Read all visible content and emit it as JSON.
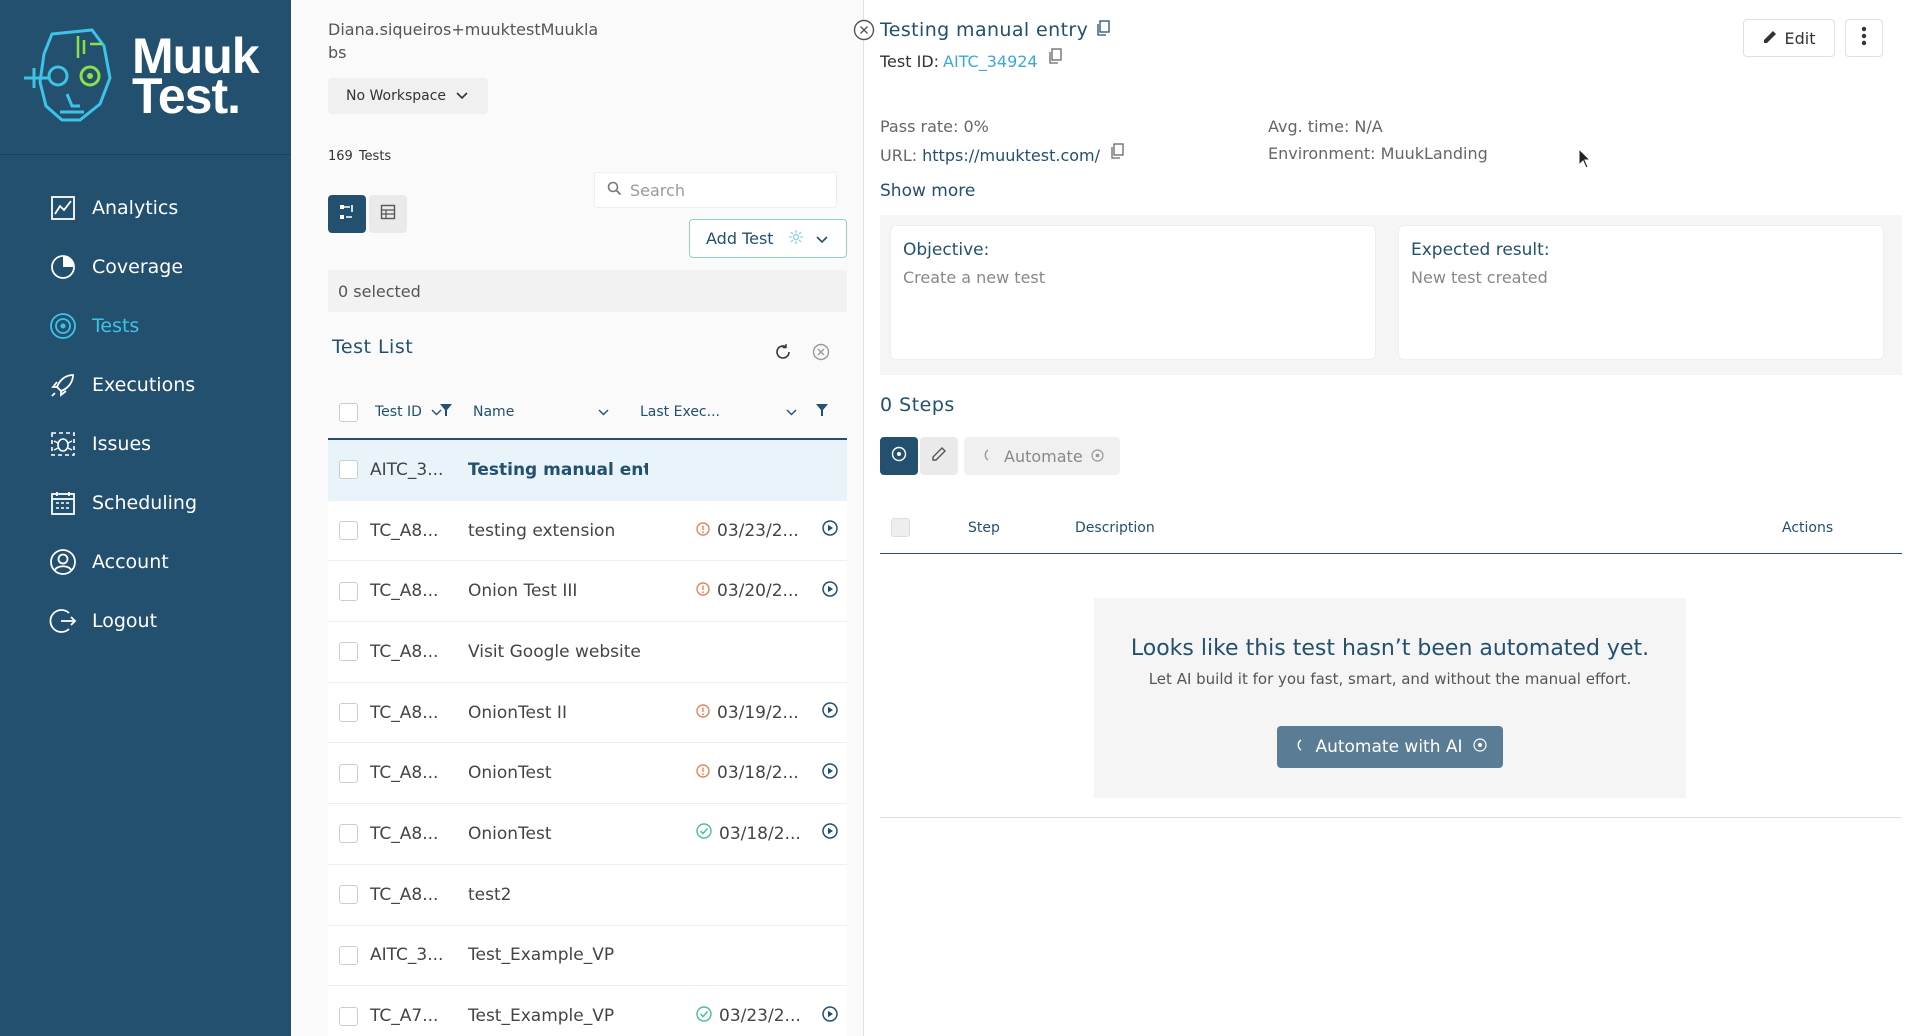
{
  "brand": {
    "line1": "Muuk",
    "line2": "Test."
  },
  "sidebar": {
    "items": [
      {
        "label": "Analytics",
        "icon": "analytics-icon",
        "active": false
      },
      {
        "label": "Coverage",
        "icon": "coverage-icon",
        "active": false
      },
      {
        "label": "Tests",
        "icon": "tests-icon",
        "active": true
      },
      {
        "label": "Executions",
        "icon": "rocket-icon",
        "active": false
      },
      {
        "label": "Issues",
        "icon": "bug-icon",
        "active": false
      },
      {
        "label": "Scheduling",
        "icon": "calendar-icon",
        "active": false
      },
      {
        "label": "Account",
        "icon": "user-icon",
        "active": false
      },
      {
        "label": "Logout",
        "icon": "logout-icon",
        "active": false
      }
    ]
  },
  "user": {
    "email": "Diana.siqueiros+muuktestMuuklabs"
  },
  "workspace": {
    "label": "No Workspace"
  },
  "tests": {
    "count": "169",
    "count_label": "Tests"
  },
  "search": {
    "placeholder": "Search"
  },
  "add_test": {
    "label": "Add Test"
  },
  "selection": {
    "text": "0 selected"
  },
  "test_list": {
    "title": "Test List",
    "columns": {
      "id": "Test ID",
      "name": "Name",
      "last_exec": "Last Exec..."
    },
    "rows": [
      {
        "id": "AITC_3...",
        "name": "Testing manual ent...",
        "status": "",
        "date": "",
        "selected": true
      },
      {
        "id": "TC_A8...",
        "name": "testing extension",
        "status": "warning",
        "date": "03/23/2..."
      },
      {
        "id": "TC_A8...",
        "name": "Onion Test III",
        "status": "warning",
        "date": "03/20/2..."
      },
      {
        "id": "TC_A8...",
        "name": "Visit Google website",
        "status": "",
        "date": ""
      },
      {
        "id": "TC_A8...",
        "name": "OnionTest II",
        "status": "warning",
        "date": "03/19/2..."
      },
      {
        "id": "TC_A8...",
        "name": "OnionTest",
        "status": "warning",
        "date": "03/18/2..."
      },
      {
        "id": "TC_A8...",
        "name": "OnionTest",
        "status": "success",
        "date": "03/18/2..."
      },
      {
        "id": "TC_A8...",
        "name": "test2",
        "status": "",
        "date": ""
      },
      {
        "id": "AITC_3...",
        "name": "Test_Example_VP",
        "status": "",
        "date": ""
      },
      {
        "id": "TC_A7...",
        "name": "Test_Example_VP",
        "status": "success",
        "date": "03/23/2..."
      }
    ]
  },
  "detail": {
    "title": "Testing manual entry",
    "test_id_label": "Test ID:",
    "test_id": "AITC_34924",
    "edit_label": "Edit",
    "pass_rate": "Pass rate: 0%",
    "avg_time": "Avg. time: N/A",
    "url_label": "URL:",
    "url": "https://muuktest.com/",
    "environment": "Environment: MuukLanding",
    "show_more": "Show more",
    "objective_label": "Objective:",
    "objective": "Create a new test",
    "expected_label": "Expected result:",
    "expected": "New test created",
    "steps_title": "0 Steps",
    "automate_label": "Automate",
    "step_columns": {
      "step": "Step",
      "description": "Description",
      "actions": "Actions"
    },
    "empty_title": "Looks like this test hasn’t been automated yet.",
    "empty_sub": "Let AI build it for you fast, smart, and without the manual effort.",
    "ai_button": "Automate with AI"
  },
  "colors": {
    "sidebar": "#22506e",
    "accent": "#3ec3e6",
    "primary": "#22506e",
    "warning": "#e8835a",
    "success": "#4cbf8e"
  }
}
